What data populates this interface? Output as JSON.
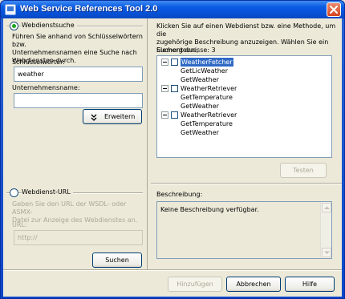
{
  "window": {
    "title": "Web Service References Tool 2.0"
  },
  "left": {
    "search_radio_label": "Webdienstsuche",
    "search_description": "Führen Sie anhand von Schlüsselwörtern bzw.\nUnternehmensnamen eine Suche nach\nWebdiensten durch.",
    "keywords_label": "Schlüsselwörter:",
    "keywords_value": "weather",
    "company_label": "Unternehmensname:",
    "company_value": "",
    "expand_button": "Erweitern",
    "url_radio_label": "Webdienst-URL",
    "url_description": "Geben Sie den URL der WSDL- oder ASMX-\nDatei zur Anzeige des Webdienstes an.",
    "url_label": "URL:",
    "url_placeholder": "http://",
    "search_button": "Suchen"
  },
  "right": {
    "instructions": "Klicken Sie auf einen Webdienst bzw. eine Methode, um die\nzugehörige Beschreibung anzuzeigen. Wählen Sie ein Element aus,\num es dem Projekt hinzuzufügen.",
    "results_label": "Suchergebnisse: 3",
    "tree": [
      {
        "label": "WeatherFetcher",
        "selected": true,
        "methods": [
          "GetLicWeather",
          "GetWeather"
        ]
      },
      {
        "label": "WeatherRetriever",
        "selected": false,
        "methods": [
          "GetTemperature",
          "GetWeather"
        ]
      },
      {
        "label": "WeatherRetriever",
        "selected": false,
        "methods": [
          "GetTemperature",
          "GetWeather"
        ]
      }
    ],
    "test_button": "Testen",
    "description_label": "Beschreibung:",
    "description_text": "Keine Beschreibung verfügbar."
  },
  "footer": {
    "add_button": "Hinzufügen",
    "cancel_button": "Abbrechen",
    "help_button": "Hilfe"
  }
}
